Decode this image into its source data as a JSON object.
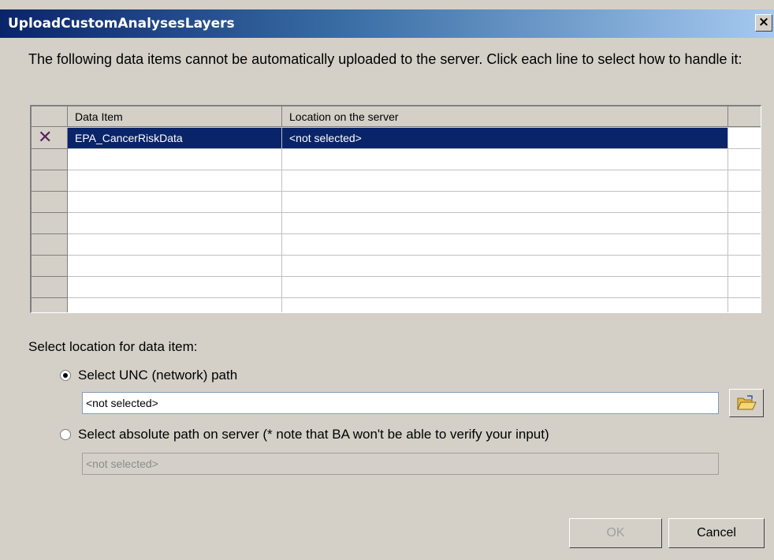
{
  "window": {
    "title": "UploadCustomAnalysesLayers",
    "close_label": "×"
  },
  "instructions": "The following data items cannot be automatically uploaded to the server. Click each line to select how to handle it:",
  "grid": {
    "columns": [
      "Data Item",
      "Location on the server"
    ],
    "rows": [
      {
        "status_icon": "x-mark-icon",
        "status_glyph": "✕",
        "data_item": "EPA_CancerRiskData",
        "location": "<not selected>",
        "selected": true
      }
    ]
  },
  "location_section": {
    "label": "Select location for data item:",
    "unc": {
      "label": "Select UNC (network) path",
      "checked": true,
      "value": "<not selected>"
    },
    "absolute": {
      "label": "Select absolute path on server (* note that BA won't be able to verify your input)",
      "checked": false,
      "value": "<not selected>"
    },
    "browse_icon": "folder-open-icon"
  },
  "buttons": {
    "ok_label": "OK",
    "cancel_label": "Cancel"
  }
}
